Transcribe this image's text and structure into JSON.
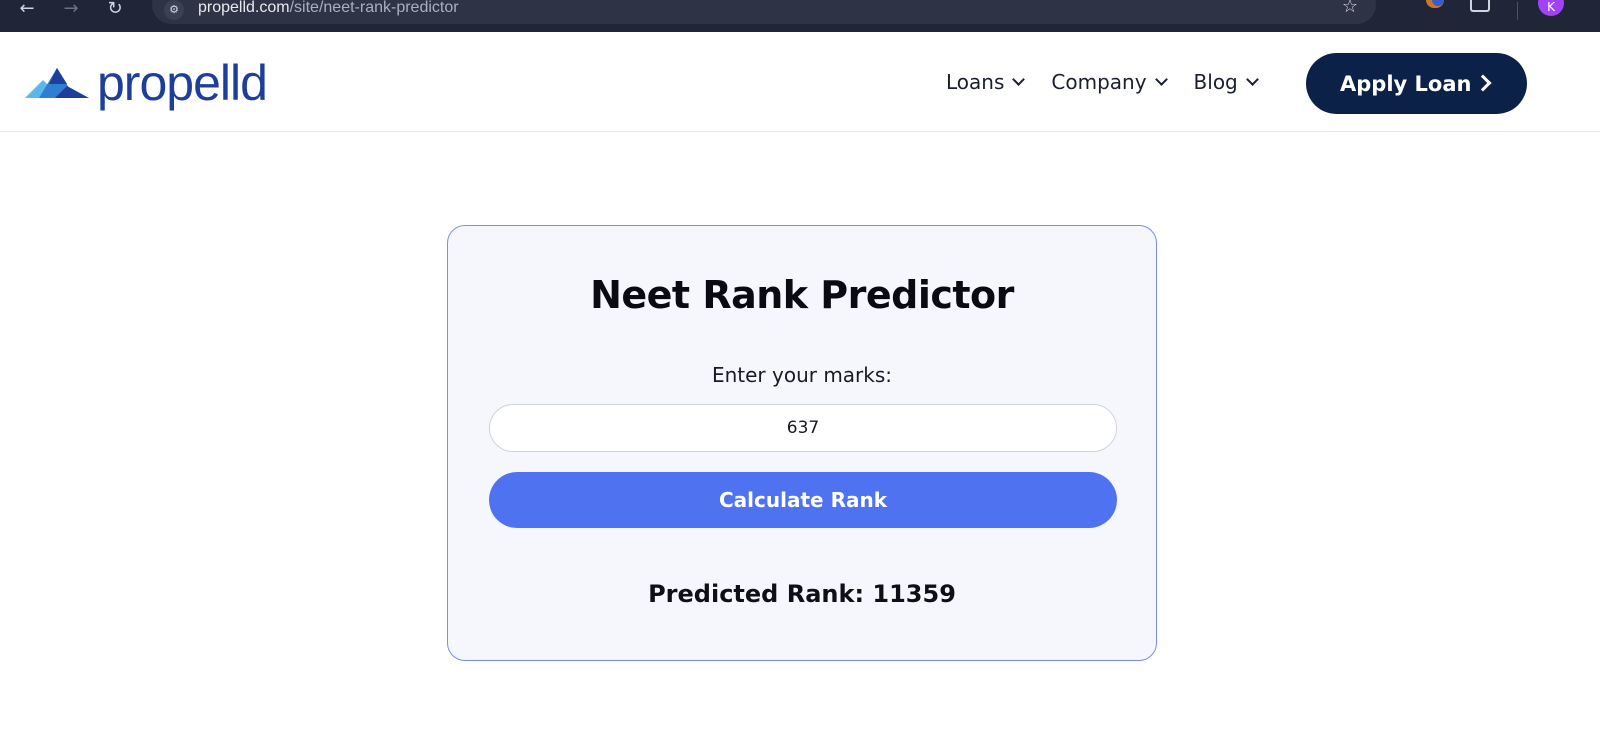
{
  "browser": {
    "url_domain": "propelld.com",
    "url_path": "/site/neet-rank-predictor",
    "profile_initial": "K",
    "back_icon": "arrow-left",
    "forward_icon": "arrow-right",
    "reload_icon": "reload",
    "bookmark_icon": "star"
  },
  "header": {
    "logo_text": "propelld",
    "nav": [
      {
        "label": "Loans"
      },
      {
        "label": "Company"
      },
      {
        "label": "Blog"
      }
    ],
    "apply_label": "Apply Loan"
  },
  "card": {
    "title": "Neet Rank Predictor",
    "marks_label": "Enter your marks:",
    "marks_value": "637",
    "button_label": "Calculate Rank",
    "result_text": "Predicted Rank: 11359"
  },
  "colors": {
    "brand": "#1d3f9b",
    "apply_bg": "#0b2147",
    "button_bg": "#4f72f0",
    "card_bg": "#f6f6fd",
    "card_border": "#7a8ef0"
  }
}
